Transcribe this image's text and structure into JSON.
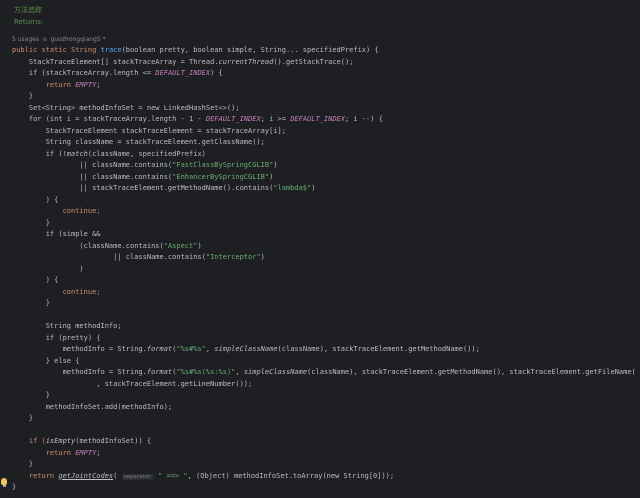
{
  "doc_comment": {
    "line1": "方法追踪",
    "line2": "Returns:"
  },
  "inlay": {
    "usages": "5 usages",
    "author": "guozhongqiang5 *"
  },
  "code": {
    "l01_sig_a": "public static String ",
    "l01_fn": "trace",
    "l01_sig_b": "(boolean pretty, boolean simple, String... specifiedPrefix) {",
    "l02_a": "    StackTraceElement[] stackTraceArray = Thread.",
    "l02_b": "currentThread",
    "l02_c": "().getStackTrace();",
    "l03_a": "    if (stackTraceArray.length <= ",
    "l03_b": "DEFAULT_INDEX",
    "l03_c": ") {",
    "l04_a": "        return ",
    "l04_b": "EMPTY",
    "l04_c": ";",
    "l05": "    }",
    "l06": "    Set<String> methodInfoSet = new LinkedHashSet<>();",
    "l07_a": "    for (int i = stackTraceArray.length - 1 - ",
    "l07_b": "DEFAULT_INDEX",
    "l07_c": "; i >= ",
    "l07_d": "DEFAULT_INDEX",
    "l07_e": "; i --) {",
    "l08": "        StackTraceElement stackTraceElement = stackTraceArray[i];",
    "l09": "        String className = stackTraceElement.getClassName();",
    "l10_a": "        if (!",
    "l10_b": "match",
    "l10_c": "(className, specifiedPrefix)",
    "l11_a": "                || className.contains(",
    "l11_b": "\"FastClassBySpringCGLIB\"",
    "l11_c": ")",
    "l12_a": "                || className.contains(",
    "l12_b": "\"EnhancerBySpringCGLIB\"",
    "l12_c": ")",
    "l13_a": "                || stackTraceElement.getMethodName().contains(",
    "l13_b": "\"lambda$\"",
    "l13_c": ")",
    "l14": "        ) {",
    "l15": "            continue;",
    "l16": "        }",
    "l17": "        if (simple &&",
    "l18_a": "                (className.contains(",
    "l18_b": "\"Aspect\"",
    "l18_c": ")",
    "l19_a": "                        || className.contains(",
    "l19_b": "\"Interceptor\"",
    "l19_c": ")",
    "l20": "                )",
    "l21": "        ) {",
    "l22": "            continue;",
    "l23": "        }",
    "l24": "",
    "l25": "        String methodInfo;",
    "l26": "        if (pretty) {",
    "l27_a": "            methodInfo = String.",
    "l27_b": "format",
    "l27_c": "(",
    "l27_d": "\"%s#%s\"",
    "l27_e": ", ",
    "l27_f": "simpleClassName",
    "l27_g": "(className), stackTraceElement.getMethodName());",
    "l28": "        } else {",
    "l29_a": "            methodInfo = String.",
    "l29_b": "format",
    "l29_c": "(",
    "l29_d": "\"%s#%s(%s:%s)\"",
    "l29_e": ", ",
    "l29_f": "simpleClassName",
    "l29_g": "(className), stackTraceElement.getMethodName(), stackTraceElement.getFileName()",
    "l30": "                    , stackTraceElement.getLineNumber());",
    "l31": "        }",
    "l32": "        methodInfoSet.add(methodInfo);",
    "l33": "    }",
    "l34": "",
    "l35_a": "    if (",
    "l35_b": "isEmpty",
    "l35_c": "(methodInfoSet)) {",
    "l36_a": "        return ",
    "l36_b": "EMPTY",
    "l36_c": ";",
    "l37": "    }",
    "l38_a": "    return ",
    "l38_b": "getJointCodes",
    "l38_c": "( ",
    "l38_hint": "separator:",
    "l38_d": " \" ==> \"",
    "l38_e": ", (Object) methodInfoSet.toArray(new String[0]));",
    "l39": "}"
  },
  "colors": {
    "background": "#1e1f22",
    "keyword": "#cf8e6d",
    "method": "#56a8f5",
    "string": "#6aab73",
    "constant": "#c77dbb",
    "text": "#bcbec4",
    "comment": "#5f8c4e"
  }
}
